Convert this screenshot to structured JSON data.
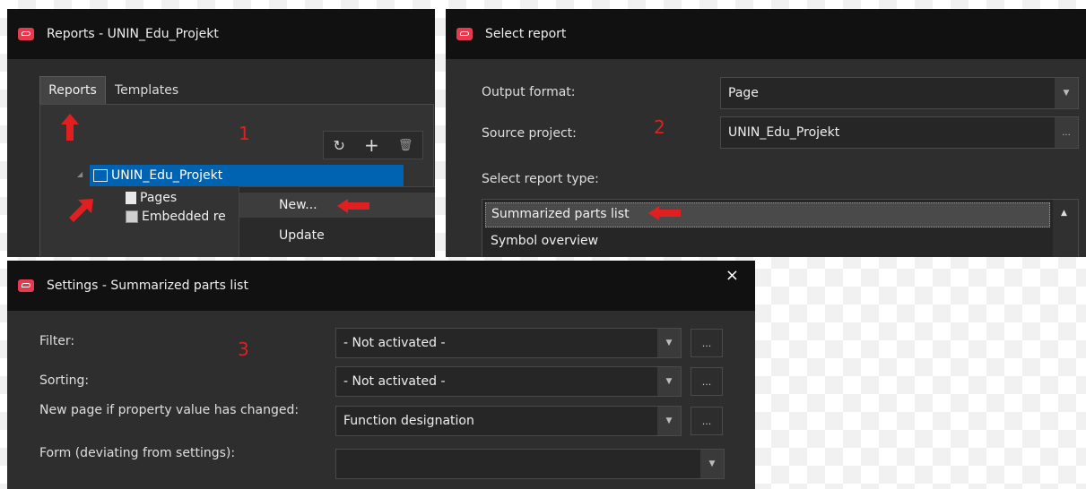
{
  "panel1": {
    "title": "Reports - UNIN_Edu_Projekt",
    "tabs": [
      "Reports",
      "Templates"
    ],
    "step": "1",
    "tree": {
      "root": "UNIN_Edu_Projekt",
      "children": [
        "Pages",
        "Embedded re"
      ]
    },
    "context_menu": [
      "New...",
      "Update"
    ],
    "toolbar_icons": [
      "refresh-icon",
      "plus-icon",
      "trash-icon"
    ]
  },
  "panel2": {
    "title": "Select report",
    "step": "2",
    "output_format_label": "Output format:",
    "output_format_value": "Page",
    "source_project_label": "Source project:",
    "source_project_value": "UNIN_Edu_Projekt",
    "source_project_btn": "...",
    "report_type_label": "Select report type:",
    "report_types": [
      "Summarized parts list",
      "Symbol overview"
    ]
  },
  "panel3": {
    "title": "Settings - Summarized parts list",
    "close": "×",
    "step": "3",
    "filter_label": "Filter:",
    "filter_value": "- Not activated -",
    "sorting_label": "Sorting:",
    "sorting_value": "- Not activated -",
    "newpage_label": "New page if property value has changed:",
    "newpage_value": "Function designation",
    "form_label": "Form (deviating from settings):",
    "form_value": "",
    "dots": "..."
  },
  "colors": {
    "accent_red": "#e02020",
    "selection_blue": "#0063b1",
    "title_bg": "#111111",
    "panel_bg": "#333333",
    "logo_red": "#e63b4f"
  }
}
